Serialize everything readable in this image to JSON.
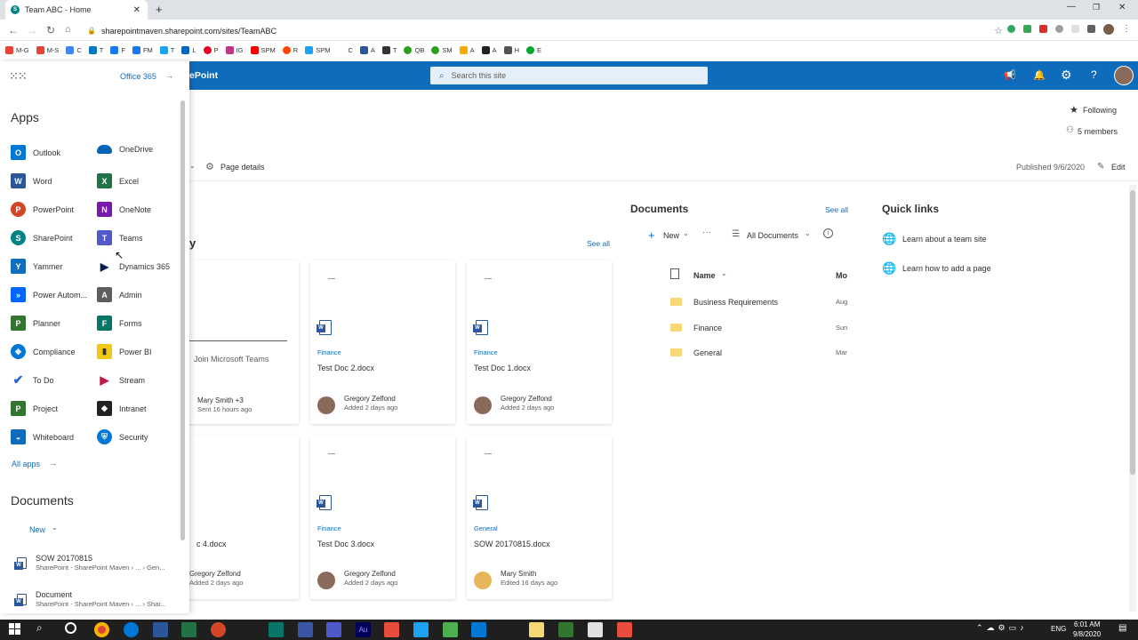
{
  "browser": {
    "tab_title": "Team ABC - Home",
    "url": "sharepointmaven.sharepoint.com/sites/TeamABC",
    "bookmarks": [
      "M-G",
      "M-S",
      "C",
      "T",
      "F",
      "FM",
      "T",
      "L",
      "P",
      "IG",
      "SPM",
      "R",
      "SPM",
      "C",
      "A",
      "T",
      "QB",
      "SM",
      "A",
      "A",
      "H",
      "E"
    ]
  },
  "header": {
    "brand_suffix": "ePoint",
    "search_placeholder": "Search this site"
  },
  "site": {
    "following": "Following",
    "members": "5 members",
    "page_details": "Page details",
    "published": "Published 9/6/2020",
    "edit": "Edit"
  },
  "panel": {
    "office365": "Office 365",
    "apps_heading": "Apps",
    "apps_left": [
      "Outlook",
      "Word",
      "PowerPoint",
      "SharePoint",
      "Yammer",
      "Power Autom...",
      "Planner",
      "Compliance",
      "To Do",
      "Project",
      "Whiteboard"
    ],
    "apps_right": [
      "OneDrive",
      "Excel",
      "OneNote",
      "Teams",
      "Dynamics 365",
      "Admin",
      "Forms",
      "Power BI",
      "Stream",
      "Intranet",
      "Security"
    ],
    "all_apps": "All apps",
    "docs_heading": "Documents",
    "docs_new": "New",
    "recent_docs": [
      {
        "name": "SOW 20170815",
        "path": "SharePoint - SharePoint Maven › ... › Gen..."
      },
      {
        "name": "Document",
        "path": "SharePoint - SharePoint Maven › ... › Shar..."
      }
    ]
  },
  "activity": {
    "heading_fragment": "y",
    "see_all": "See all",
    "cards": [
      {
        "category": "",
        "title": "Join Microsoft Teams",
        "person": "Mary Smith +3",
        "meta": "Sent 16 hours ago"
      },
      {
        "category": "Finance",
        "title": "Test Doc 2.docx",
        "person": "Gregory Zelfond",
        "meta": "Added 2 days ago"
      },
      {
        "category": "Finance",
        "title": "Test Doc 1.docx",
        "person": "Gregory Zelfond",
        "meta": "Added 2 days ago"
      },
      {
        "category": "",
        "title": "c 4.docx",
        "person": "Gregory Zelfond",
        "meta": "Added 2 days ago"
      },
      {
        "category": "Finance",
        "title": "Test Doc 3.docx",
        "person": "Gregory Zelfond",
        "meta": "Added 2 days ago"
      },
      {
        "category": "General",
        "title": "SOW 20170815.docx",
        "person": "Mary Smith",
        "meta": "Edited 16 days ago"
      }
    ]
  },
  "documents": {
    "heading": "Documents",
    "see_all": "See all",
    "new": "New",
    "view": "All Documents",
    "col_name": "Name",
    "col_modified": "Mo",
    "rows": [
      {
        "name": "Business Requirements",
        "modified": "Aug"
      },
      {
        "name": "Finance",
        "modified": "Sun"
      },
      {
        "name": "General",
        "modified": "Mar"
      }
    ]
  },
  "quick_links": {
    "heading": "Quick links",
    "items": [
      "Learn about a team site",
      "Learn how to add a page"
    ]
  },
  "taskbar": {
    "lang": "ENG",
    "time": "6:01 AM",
    "date": "9/8/2020"
  }
}
